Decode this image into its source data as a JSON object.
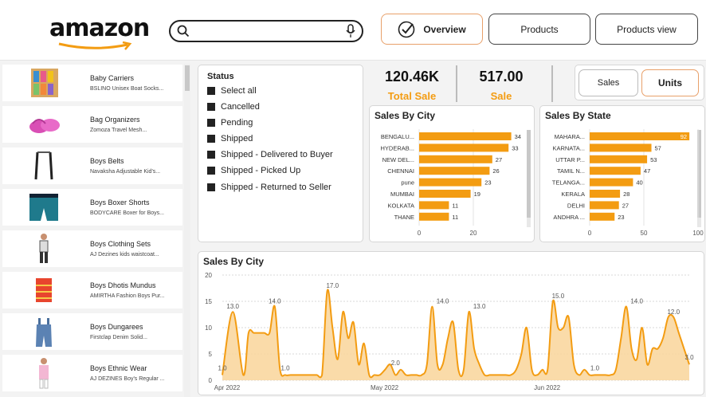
{
  "brand": "amazon",
  "search": {
    "placeholder": ""
  },
  "nav": {
    "overview": "Overview",
    "products": "Products",
    "products_view": "Products view"
  },
  "products": [
    {
      "name": "Baby Carriers",
      "desc": "BSLINO Unisex Boat Socks..."
    },
    {
      "name": "Bag Organizers",
      "desc": "Zomoza Travel Mesh..."
    },
    {
      "name": "Boys Belts",
      "desc": "Navaksha Adjustable Kid's..."
    },
    {
      "name": "Boys Boxer Shorts",
      "desc": "BODYCARE Boxer for Boys..."
    },
    {
      "name": "Boys Clothing Sets",
      "desc": "AJ Dezines kids waistcoat..."
    },
    {
      "name": "Boys Dhotis Mundus",
      "desc": "AMIRTHA Fashion Boys Pur..."
    },
    {
      "name": "Boys Dungarees",
      "desc": "Firstclap Denim Solid..."
    },
    {
      "name": "Boys Ethnic Wear",
      "desc": "AJ DEZINES Boy's Regular ..."
    }
  ],
  "status": {
    "title": "Status",
    "items": [
      "Select all",
      "Cancelled",
      "Pending",
      "Shipped",
      "Shipped - Delivered to Buyer",
      "Shipped - Picked Up",
      "Shipped - Returned to Seller"
    ]
  },
  "kpis": [
    {
      "value": "120.46K",
      "label": "Total Sale"
    },
    {
      "value": "517.00",
      "label": "Sale"
    }
  ],
  "toggles": {
    "sales": "Sales",
    "units": "Units"
  },
  "colors": {
    "accent": "#f39c12",
    "area_fill": "#f9d7a0",
    "highlight_bar": "#f39c12"
  },
  "chart_data": [
    {
      "type": "bar",
      "orientation": "horizontal",
      "title": "Sales By City",
      "categories": [
        "BENGALU...",
        "HYDERAB...",
        "NEW DEL...",
        "CHENNAI",
        "pune",
        "MUMBAI",
        "KOLKATA",
        "THANE"
      ],
      "values": [
        34,
        33,
        27,
        26,
        23,
        19,
        11,
        11
      ],
      "xticks": [
        "0",
        "20"
      ],
      "xlim": [
        0,
        40
      ]
    },
    {
      "type": "bar",
      "orientation": "horizontal",
      "title": "Sales By State",
      "categories": [
        "MAHARA...",
        "KARNATA...",
        "UTTAR P...",
        "TAMIL N...",
        "TELANGA...",
        "KERALA",
        "DELHI",
        "ANDHRA ..."
      ],
      "values": [
        92,
        57,
        53,
        47,
        40,
        28,
        27,
        23
      ],
      "xticks": [
        "0",
        "50",
        "100"
      ],
      "xlim": [
        0,
        100
      ]
    },
    {
      "type": "area",
      "title": "Sales By City",
      "ylim": [
        0,
        20
      ],
      "yticks": [
        "0",
        "5",
        "10",
        "15",
        "20"
      ],
      "xlabels": [
        "Apr 2022",
        "May 2022",
        "Jun 2022"
      ],
      "xlabel_days": [
        1,
        31,
        62
      ],
      "x": [
        1,
        3,
        5,
        6,
        7,
        8,
        9,
        10,
        11,
        12,
        13,
        14,
        15,
        16,
        17,
        18,
        19,
        20,
        21,
        22,
        23,
        24,
        25,
        26,
        27,
        28,
        29,
        30,
        31,
        32,
        33,
        34,
        35,
        36,
        37,
        38,
        39,
        40,
        41,
        42,
        43,
        44,
        45,
        46,
        47,
        48,
        49,
        50,
        51,
        52,
        53,
        54,
        55,
        56,
        57,
        58,
        59,
        60,
        61,
        62,
        63,
        64,
        65,
        66,
        67,
        68,
        69,
        70,
        71,
        72,
        73,
        74,
        75,
        76,
        77,
        78,
        79,
        80,
        81,
        82,
        83,
        84,
        85,
        86,
        87,
        88,
        89,
        90
      ],
      "values": [
        1,
        13,
        1,
        9,
        9,
        9,
        9,
        9,
        14,
        2,
        1,
        1,
        1,
        1,
        1,
        1,
        1,
        1,
        17,
        10,
        4,
        13,
        8,
        11,
        3,
        7,
        1,
        1,
        1,
        2,
        3,
        1,
        2,
        1,
        1,
        1,
        1,
        3,
        14,
        3,
        3,
        8,
        11,
        2,
        2,
        13,
        6,
        3,
        1,
        1,
        1,
        1,
        1,
        1,
        2,
        5,
        10,
        2,
        1,
        2,
        2,
        15,
        10,
        10,
        12,
        3,
        1,
        2,
        1,
        1,
        1,
        1,
        1,
        2,
        8,
        14,
        6,
        4,
        10,
        3,
        6,
        6,
        8,
        12,
        12,
        9,
        6,
        3,
        3,
        3
      ],
      "data_labels": [
        {
          "x": 1,
          "y": 1,
          "text": "1.0"
        },
        {
          "x": 3,
          "y": 13,
          "text": "13.0"
        },
        {
          "x": 11,
          "y": 14,
          "text": "14.0"
        },
        {
          "x": 13,
          "y": 1,
          "text": "1.0"
        },
        {
          "x": 22,
          "y": 17,
          "text": "17.0"
        },
        {
          "x": 34,
          "y": 2,
          "text": "2.0"
        },
        {
          "x": 43,
          "y": 14,
          "text": "14.0"
        },
        {
          "x": 50,
          "y": 13,
          "text": "13.0"
        },
        {
          "x": 65,
          "y": 15,
          "text": "15.0"
        },
        {
          "x": 72,
          "y": 1,
          "text": "1.0"
        },
        {
          "x": 80,
          "y": 14,
          "text": "14.0"
        },
        {
          "x": 87,
          "y": 12,
          "text": "12.0"
        },
        {
          "x": 90,
          "y": 3,
          "text": "3.0"
        }
      ]
    }
  ]
}
